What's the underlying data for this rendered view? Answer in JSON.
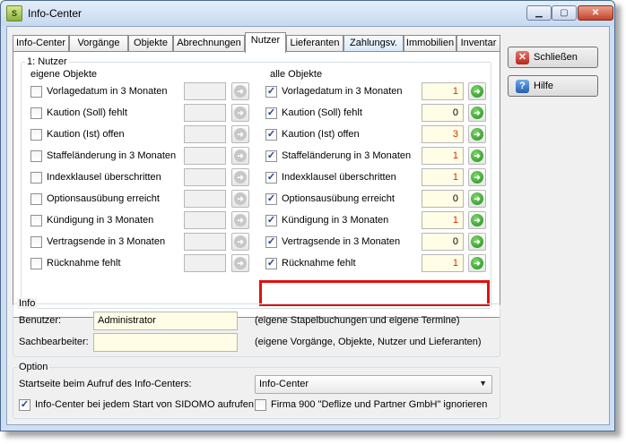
{
  "window": {
    "title": "Info-Center",
    "app_icon": "app-logo-icon",
    "controls": {
      "minimize": "▁",
      "maximize": "▢",
      "close": "✕"
    }
  },
  "tabs": [
    {
      "label": "Info-Center"
    },
    {
      "label": "Vorgänge"
    },
    {
      "label": "Objekte"
    },
    {
      "label": "Abrechnungen"
    },
    {
      "label": "Nutzer"
    },
    {
      "label": "Lieferanten"
    },
    {
      "label": "Zahlungsv."
    },
    {
      "label": "Immobilien"
    },
    {
      "label": "Inventar"
    }
  ],
  "active_tab": "Nutzer",
  "nutzer": {
    "group_label": "1: Nutzer",
    "own_heading": "eigene Objekte",
    "all_heading": "alle Objekte",
    "rows": [
      {
        "label": "Vorlagedatum in 3 Monaten",
        "own_checked": false,
        "all_checked": true,
        "all_value": "1",
        "all_value_color": "#d03000"
      },
      {
        "label": "Kaution (Soll) fehlt",
        "own_checked": false,
        "all_checked": true,
        "all_value": "0",
        "all_value_color": "#000000"
      },
      {
        "label": "Kaution (Ist) offen",
        "own_checked": false,
        "all_checked": true,
        "all_value": "3",
        "all_value_color": "#d03000"
      },
      {
        "label": "Staffeländerung in 3 Monaten",
        "own_checked": false,
        "all_checked": true,
        "all_value": "1",
        "all_value_color": "#d03000"
      },
      {
        "label": "Indexklausel überschritten",
        "own_checked": false,
        "all_checked": true,
        "all_value": "1",
        "all_value_color": "#d03000"
      },
      {
        "label": "Optionsausübung erreicht",
        "own_checked": false,
        "all_checked": true,
        "all_value": "0",
        "all_value_color": "#000000"
      },
      {
        "label": "Kündigung in 3 Monaten",
        "own_checked": false,
        "all_checked": true,
        "all_value": "1",
        "all_value_color": "#d03000"
      },
      {
        "label": "Vertragsende in 3 Monaten",
        "own_checked": false,
        "all_checked": true,
        "all_value": "0",
        "all_value_color": "#000000"
      },
      {
        "label": "Rücknahme fehlt",
        "own_checked": false,
        "all_checked": true,
        "all_value": "1",
        "all_value_color": "#d03000"
      }
    ]
  },
  "info": {
    "section_label": "Info",
    "benutzer_label": "Benutzer:",
    "benutzer_value": "Administrator",
    "benutzer_hint": "(eigene Stapelbuchungen und eigene Termine)",
    "sachbearbeiter_label": "Sachbearbeiter:",
    "sachbearbeiter_value": "",
    "sachbearbeiter_hint": "(eigene Vorgänge, Objekte, Nutzer und Lieferanten)"
  },
  "option": {
    "section_label": "Option",
    "startseite_label": "Startseite beim Aufruf des Info-Centers:",
    "startseite_value": "Info-Center",
    "autostart_label": "Info-Center bei jedem Start von SIDOMO aufrufen",
    "autostart_checked": true,
    "ignore_label": "Firma 900 \"Deflize und Partner GmbH\" ignorieren",
    "ignore_checked": false
  },
  "buttons": {
    "close_label": "Schließen",
    "help_label": "Hilfe"
  },
  "colors": {
    "highlight": "#e01010",
    "input_bg": "#fffde6"
  }
}
